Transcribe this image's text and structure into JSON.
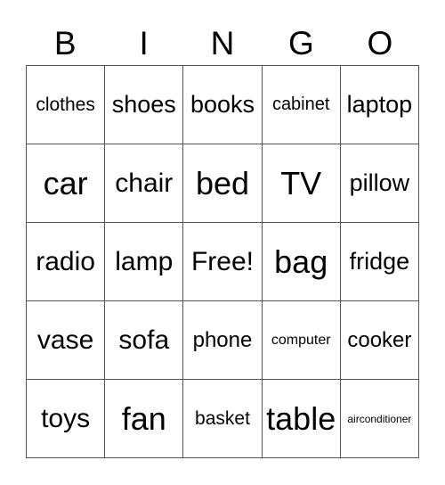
{
  "header": [
    "B",
    "I",
    "N",
    "G",
    "O"
  ],
  "cells": [
    [
      "clothes",
      "shoes",
      "books",
      "cabinet",
      "laptop"
    ],
    [
      "car",
      "chair",
      "bed",
      "TV",
      "pillow"
    ],
    [
      "radio",
      "lamp",
      "Free!",
      "bag",
      "fridge"
    ],
    [
      "vase",
      "sofa",
      "phone",
      "computer",
      "cooker"
    ],
    [
      "toys",
      "fan",
      "basket",
      "table",
      "airconditioner"
    ]
  ]
}
